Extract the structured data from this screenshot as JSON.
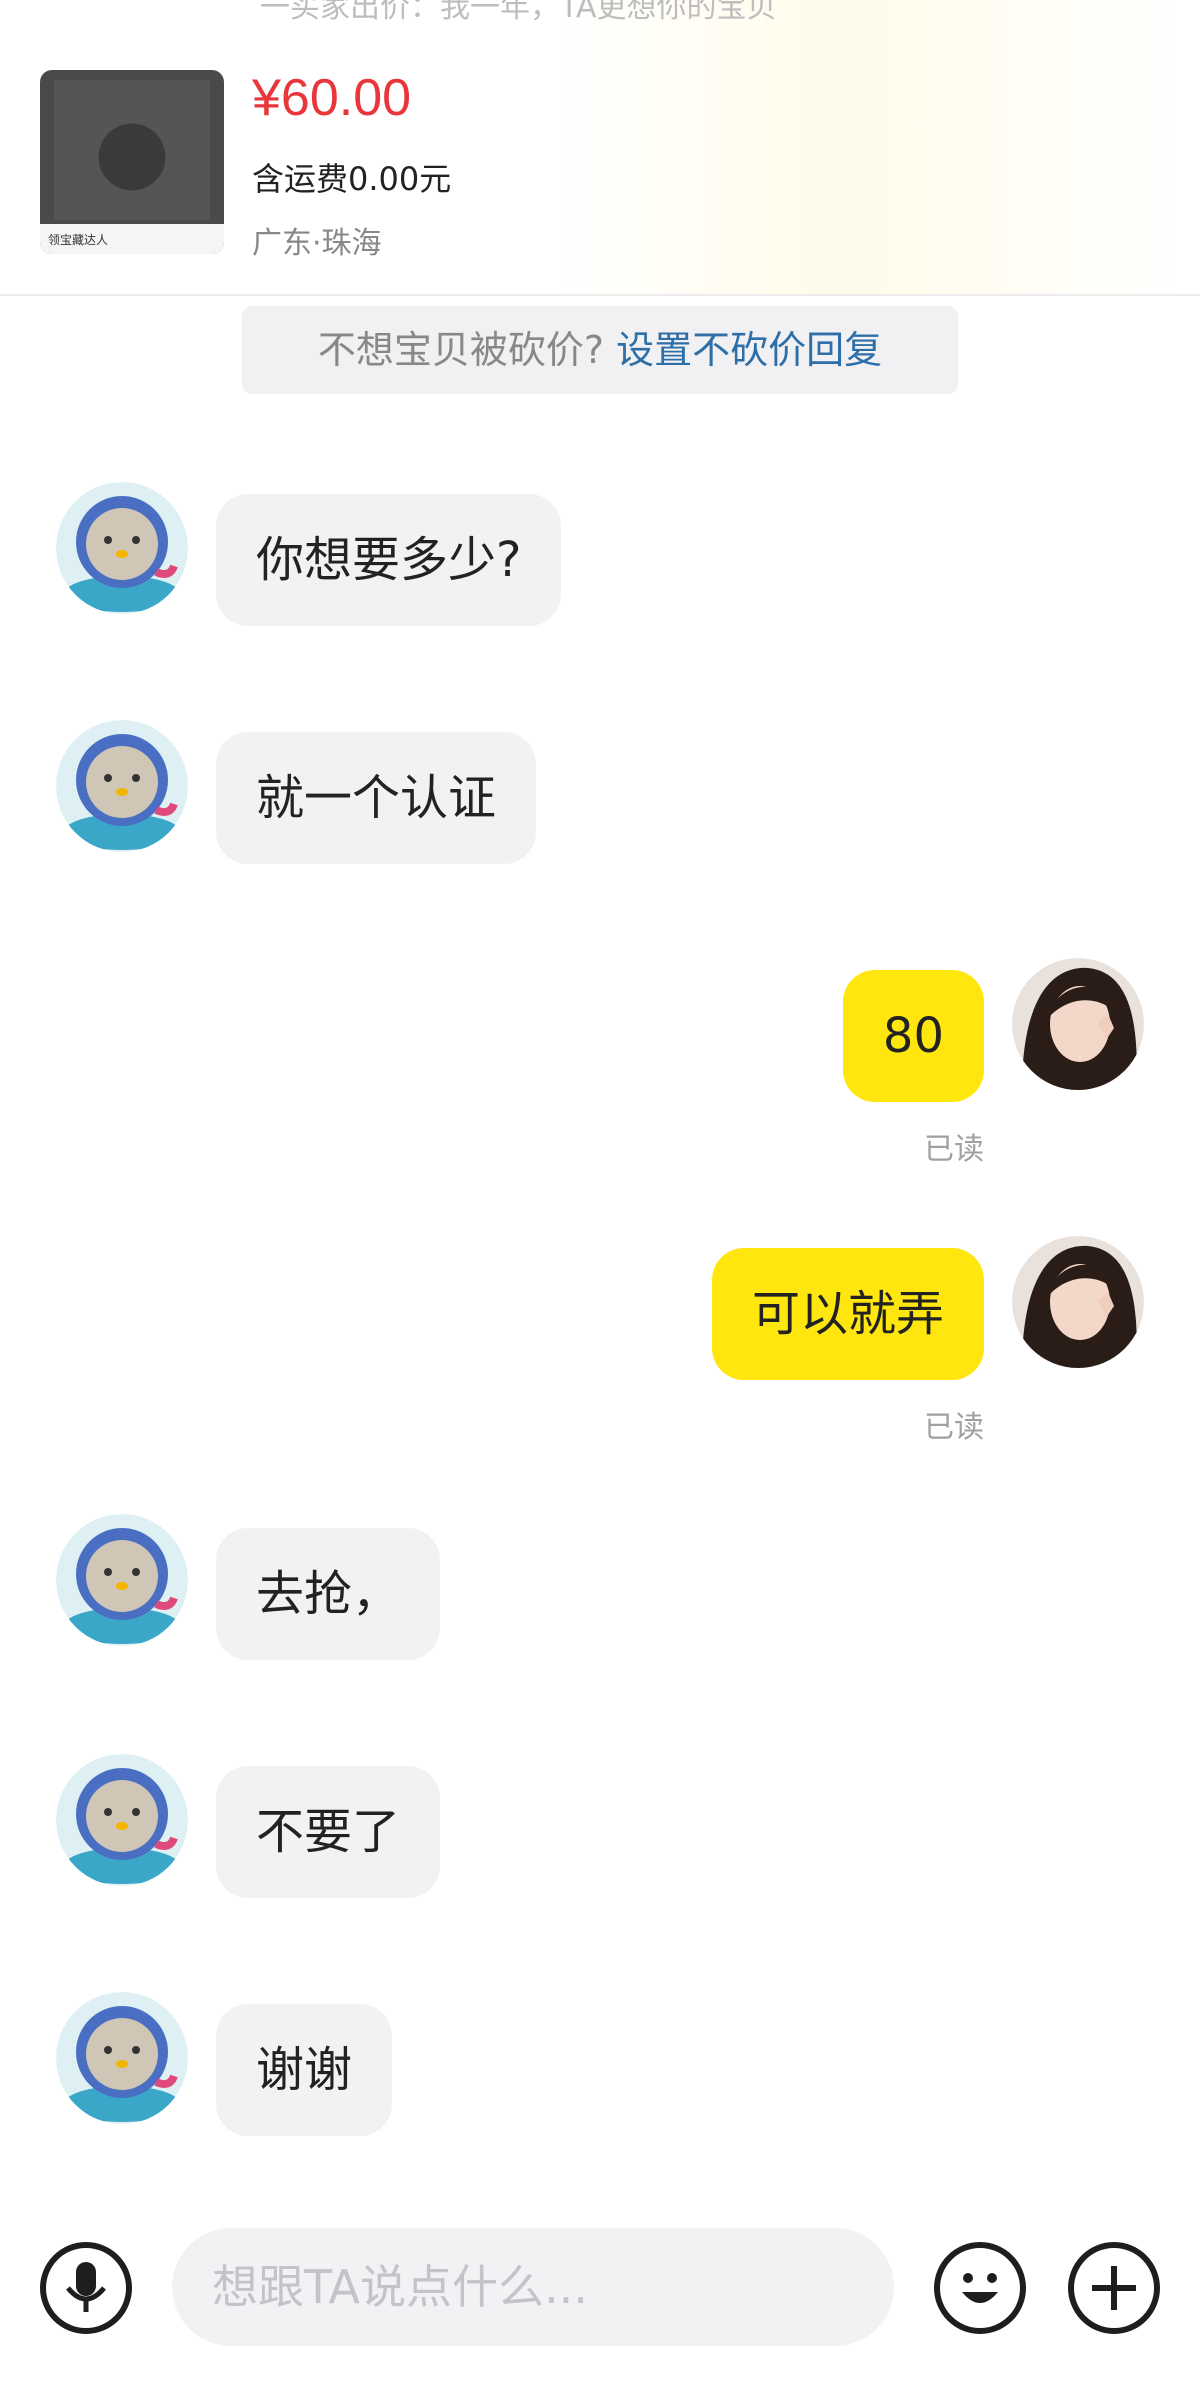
{
  "header": {
    "top_hint": "一买家出价：我一年，TA更想你的宝贝",
    "product": {
      "price": "¥60.00",
      "shipping": "含运费0.00元",
      "location": "广东·珠海",
      "thumbnail_label": "领宝藏达人"
    }
  },
  "notice": {
    "text": "不想宝贝被砍价? ",
    "link": "设置不砍价回复"
  },
  "messages": [
    {
      "side": "left",
      "text": "你想要多少?"
    },
    {
      "side": "left",
      "text": "就一个认证"
    },
    {
      "side": "right",
      "text": "80",
      "status": "已读"
    },
    {
      "side": "right",
      "text": "可以就弄",
      "status": "已读"
    },
    {
      "side": "left",
      "text": "去抢，"
    },
    {
      "side": "left",
      "text": "不要了"
    },
    {
      "side": "left",
      "text": "谢谢"
    }
  ],
  "input_bar": {
    "placeholder": "想跟TA说点什么...",
    "voice_icon": "microphone-icon",
    "emoji_icon": "smiley-icon",
    "more_icon": "plus-icon"
  },
  "colors": {
    "price": "#e8363a",
    "link": "#2f6fa8",
    "own_bubble": "#ffe60f",
    "peer_bubble": "#f2f2f4"
  }
}
